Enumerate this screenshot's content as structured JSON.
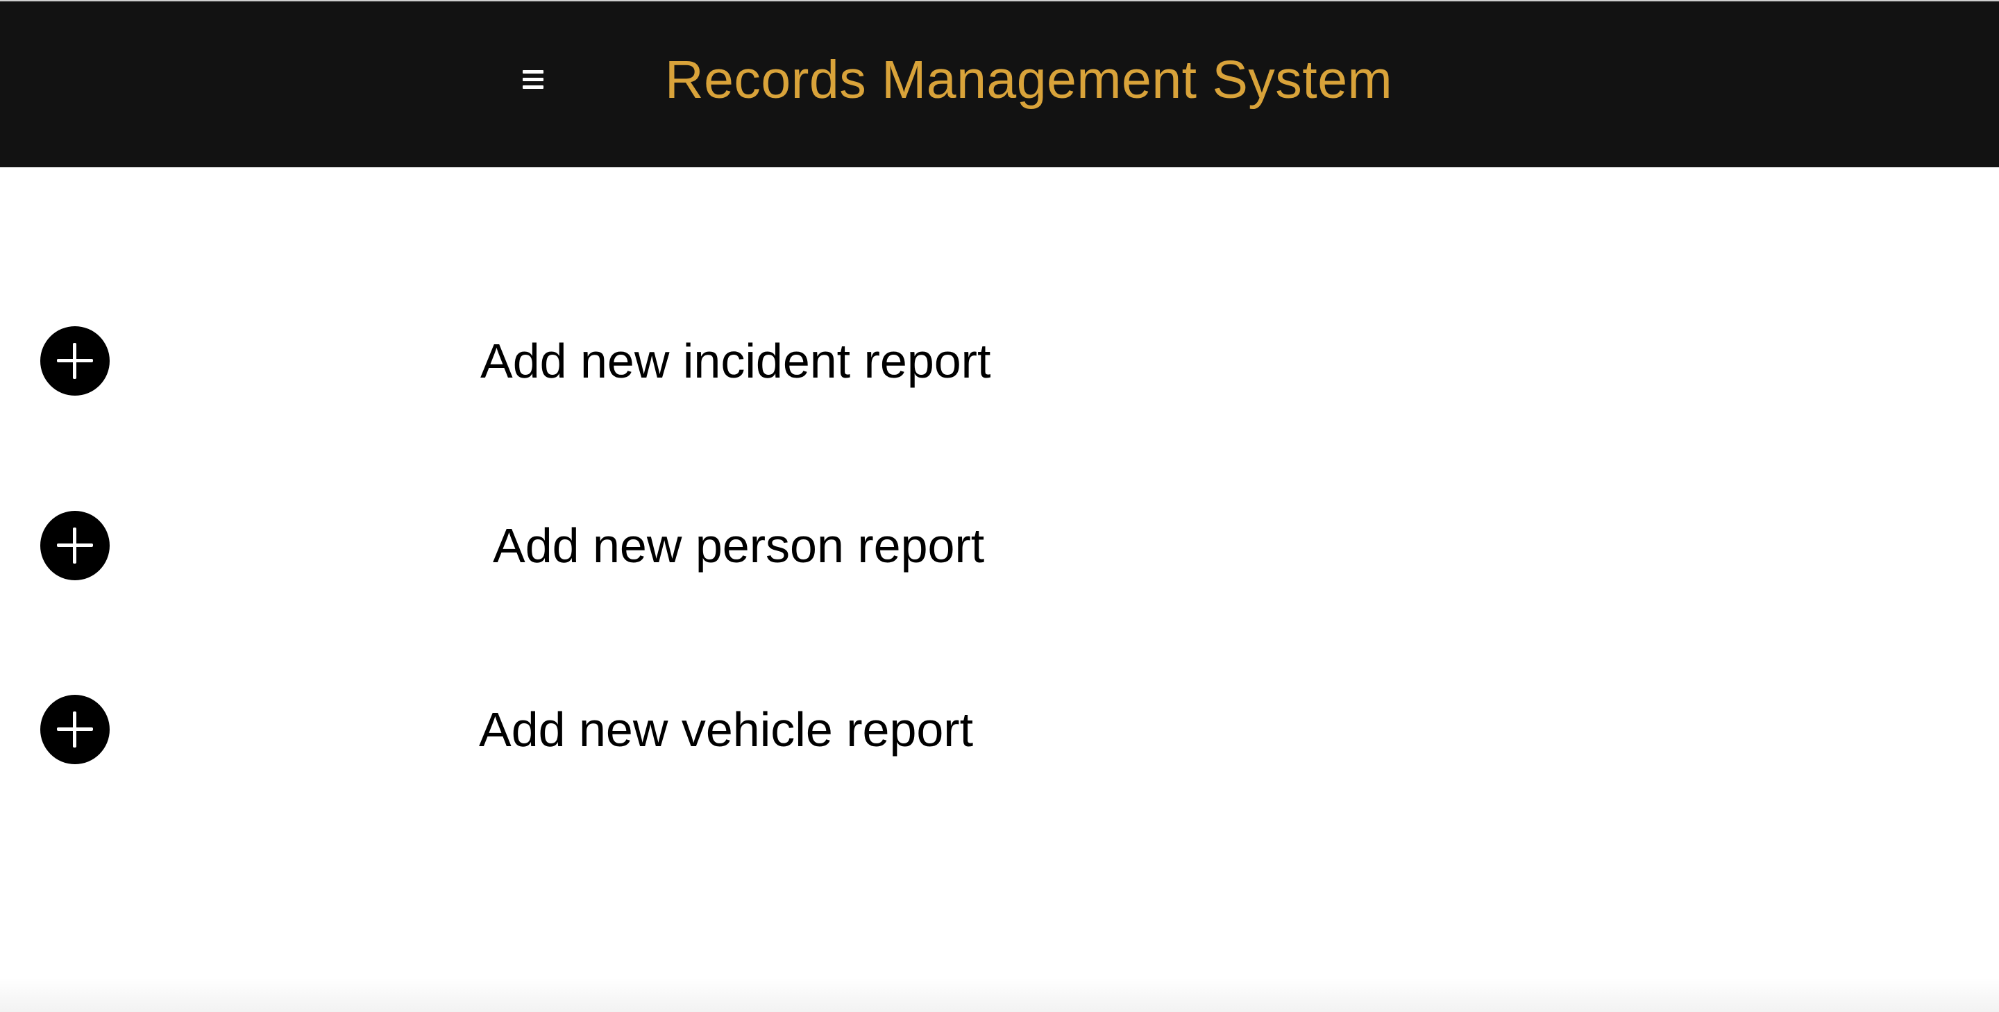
{
  "header": {
    "title": "Records Management System",
    "menu_icon": "hamburger-menu-icon"
  },
  "actions": [
    {
      "label": "Add new incident report",
      "icon": "plus-circle-icon"
    },
    {
      "label": "Add new person report",
      "icon": "plus-circle-icon"
    },
    {
      "label": "Add new vehicle report",
      "icon": "plus-circle-icon"
    }
  ],
  "colors": {
    "header_background": "#121212",
    "title": "#D9A33A",
    "page_background": "#FFFFFF",
    "text": "#000000"
  }
}
